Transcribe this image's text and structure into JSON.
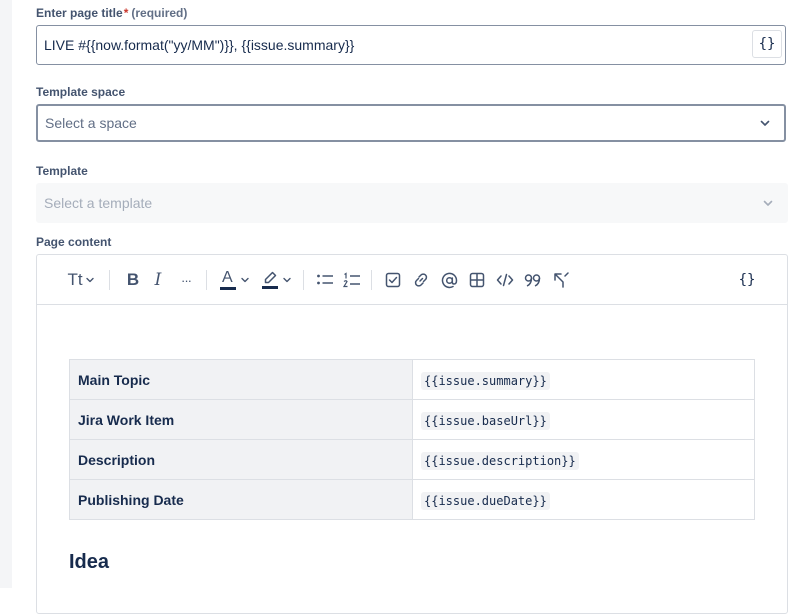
{
  "page_title_field": {
    "label": "Enter page title",
    "required_mark": "*",
    "required_text": "(required)",
    "value": "LIVE #{{now.format(\"yy/MM\")}}, {{issue.summary}}",
    "smart_value_button": "{}"
  },
  "template_space_field": {
    "label": "Template space",
    "placeholder": "Select a space"
  },
  "template_field": {
    "label": "Template",
    "placeholder": "Select a template"
  },
  "page_content": {
    "label": "Page content",
    "toolbar": {
      "text_style": "Tt",
      "bold": "B",
      "italic": "I",
      "more": "···",
      "text_color": "A",
      "smart_value": "{}"
    },
    "table_rows": [
      {
        "key": "Main Topic",
        "value": "{{issue.summary}}"
      },
      {
        "key": "Jira Work Item",
        "value": "{{issue.baseUrl}}"
      },
      {
        "key": "Description",
        "value": "{{issue.description}}"
      },
      {
        "key": "Publishing Date",
        "value": "{{issue.dueDate}}"
      }
    ],
    "heading": "Idea"
  },
  "colors": {
    "accent_text": "#172b4d",
    "label": "#44546f",
    "required": "#c9372c",
    "border": "#8590a2",
    "table_header_bg": "#f1f2f4",
    "text_color_swatch": "#172b4d"
  }
}
